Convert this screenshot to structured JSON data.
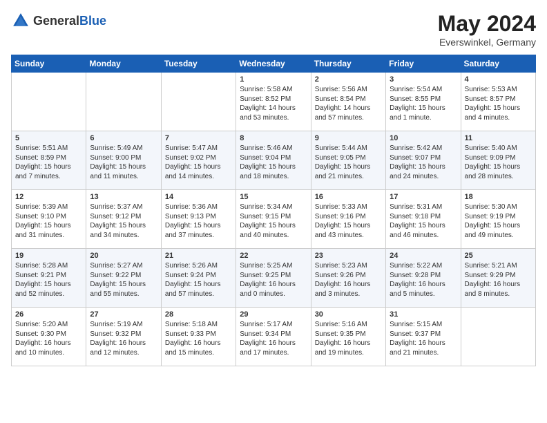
{
  "header": {
    "logo_general": "General",
    "logo_blue": "Blue",
    "title": "May 2024",
    "location": "Everswinkel, Germany"
  },
  "days_of_week": [
    "Sunday",
    "Monday",
    "Tuesday",
    "Wednesday",
    "Thursday",
    "Friday",
    "Saturday"
  ],
  "weeks": [
    [
      {
        "day": "",
        "info": ""
      },
      {
        "day": "",
        "info": ""
      },
      {
        "day": "",
        "info": ""
      },
      {
        "day": "1",
        "info": "Sunrise: 5:58 AM\nSunset: 8:52 PM\nDaylight: 14 hours\nand 53 minutes."
      },
      {
        "day": "2",
        "info": "Sunrise: 5:56 AM\nSunset: 8:54 PM\nDaylight: 14 hours\nand 57 minutes."
      },
      {
        "day": "3",
        "info": "Sunrise: 5:54 AM\nSunset: 8:55 PM\nDaylight: 15 hours\nand 1 minute."
      },
      {
        "day": "4",
        "info": "Sunrise: 5:53 AM\nSunset: 8:57 PM\nDaylight: 15 hours\nand 4 minutes."
      }
    ],
    [
      {
        "day": "5",
        "info": "Sunrise: 5:51 AM\nSunset: 8:59 PM\nDaylight: 15 hours\nand 7 minutes."
      },
      {
        "day": "6",
        "info": "Sunrise: 5:49 AM\nSunset: 9:00 PM\nDaylight: 15 hours\nand 11 minutes."
      },
      {
        "day": "7",
        "info": "Sunrise: 5:47 AM\nSunset: 9:02 PM\nDaylight: 15 hours\nand 14 minutes."
      },
      {
        "day": "8",
        "info": "Sunrise: 5:46 AM\nSunset: 9:04 PM\nDaylight: 15 hours\nand 18 minutes."
      },
      {
        "day": "9",
        "info": "Sunrise: 5:44 AM\nSunset: 9:05 PM\nDaylight: 15 hours\nand 21 minutes."
      },
      {
        "day": "10",
        "info": "Sunrise: 5:42 AM\nSunset: 9:07 PM\nDaylight: 15 hours\nand 24 minutes."
      },
      {
        "day": "11",
        "info": "Sunrise: 5:40 AM\nSunset: 9:09 PM\nDaylight: 15 hours\nand 28 minutes."
      }
    ],
    [
      {
        "day": "12",
        "info": "Sunrise: 5:39 AM\nSunset: 9:10 PM\nDaylight: 15 hours\nand 31 minutes."
      },
      {
        "day": "13",
        "info": "Sunrise: 5:37 AM\nSunset: 9:12 PM\nDaylight: 15 hours\nand 34 minutes."
      },
      {
        "day": "14",
        "info": "Sunrise: 5:36 AM\nSunset: 9:13 PM\nDaylight: 15 hours\nand 37 minutes."
      },
      {
        "day": "15",
        "info": "Sunrise: 5:34 AM\nSunset: 9:15 PM\nDaylight: 15 hours\nand 40 minutes."
      },
      {
        "day": "16",
        "info": "Sunrise: 5:33 AM\nSunset: 9:16 PM\nDaylight: 15 hours\nand 43 minutes."
      },
      {
        "day": "17",
        "info": "Sunrise: 5:31 AM\nSunset: 9:18 PM\nDaylight: 15 hours\nand 46 minutes."
      },
      {
        "day": "18",
        "info": "Sunrise: 5:30 AM\nSunset: 9:19 PM\nDaylight: 15 hours\nand 49 minutes."
      }
    ],
    [
      {
        "day": "19",
        "info": "Sunrise: 5:28 AM\nSunset: 9:21 PM\nDaylight: 15 hours\nand 52 minutes."
      },
      {
        "day": "20",
        "info": "Sunrise: 5:27 AM\nSunset: 9:22 PM\nDaylight: 15 hours\nand 55 minutes."
      },
      {
        "day": "21",
        "info": "Sunrise: 5:26 AM\nSunset: 9:24 PM\nDaylight: 15 hours\nand 57 minutes."
      },
      {
        "day": "22",
        "info": "Sunrise: 5:25 AM\nSunset: 9:25 PM\nDaylight: 16 hours\nand 0 minutes."
      },
      {
        "day": "23",
        "info": "Sunrise: 5:23 AM\nSunset: 9:26 PM\nDaylight: 16 hours\nand 3 minutes."
      },
      {
        "day": "24",
        "info": "Sunrise: 5:22 AM\nSunset: 9:28 PM\nDaylight: 16 hours\nand 5 minutes."
      },
      {
        "day": "25",
        "info": "Sunrise: 5:21 AM\nSunset: 9:29 PM\nDaylight: 16 hours\nand 8 minutes."
      }
    ],
    [
      {
        "day": "26",
        "info": "Sunrise: 5:20 AM\nSunset: 9:30 PM\nDaylight: 16 hours\nand 10 minutes."
      },
      {
        "day": "27",
        "info": "Sunrise: 5:19 AM\nSunset: 9:32 PM\nDaylight: 16 hours\nand 12 minutes."
      },
      {
        "day": "28",
        "info": "Sunrise: 5:18 AM\nSunset: 9:33 PM\nDaylight: 16 hours\nand 15 minutes."
      },
      {
        "day": "29",
        "info": "Sunrise: 5:17 AM\nSunset: 9:34 PM\nDaylight: 16 hours\nand 17 minutes."
      },
      {
        "day": "30",
        "info": "Sunrise: 5:16 AM\nSunset: 9:35 PM\nDaylight: 16 hours\nand 19 minutes."
      },
      {
        "day": "31",
        "info": "Sunrise: 5:15 AM\nSunset: 9:37 PM\nDaylight: 16 hours\nand 21 minutes."
      },
      {
        "day": "",
        "info": ""
      }
    ]
  ]
}
